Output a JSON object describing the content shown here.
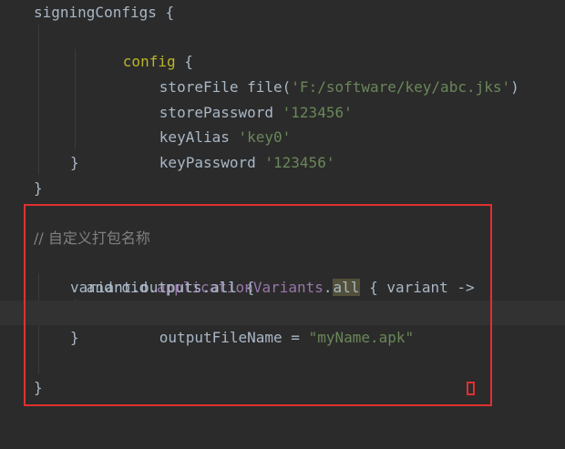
{
  "editor": {
    "line1": {
      "text": "signingConfigs {"
    },
    "line2": {
      "name": "config",
      "brace": " {"
    },
    "line3": {
      "key": "storeFile ",
      "fn": "file(",
      "value": "'F:/software/key/abc.jks'",
      "close": ")"
    },
    "line4": {
      "key": "storePassword ",
      "value": "'123456'"
    },
    "line5": {
      "key": "keyAlias ",
      "value": "'key0'"
    },
    "line6": {
      "key": "keyPassword ",
      "value": "'123456'"
    },
    "line7": {
      "text": "}"
    },
    "line8": {
      "text": "}"
    },
    "line10": {
      "comment": "// 自定义打包名称"
    },
    "line11": {
      "obj": "android.",
      "prop": "applicationVariants",
      "dot": ".",
      "all": "all",
      "rest": " { variant ->"
    },
    "line12": {
      "text": "variant.outputs.all {"
    },
    "line13": {
      "key": "outputFileName = ",
      "value": "\"myName.apk\""
    },
    "line14": {
      "text": "}"
    },
    "line16": {
      "text": "}"
    }
  },
  "colors": {
    "background": "#2b2b2b",
    "string": "#6a8759",
    "plain": "#a9b7c6",
    "property": "#9876aa",
    "comment": "#808080",
    "highlight_box": "#e03030"
  }
}
